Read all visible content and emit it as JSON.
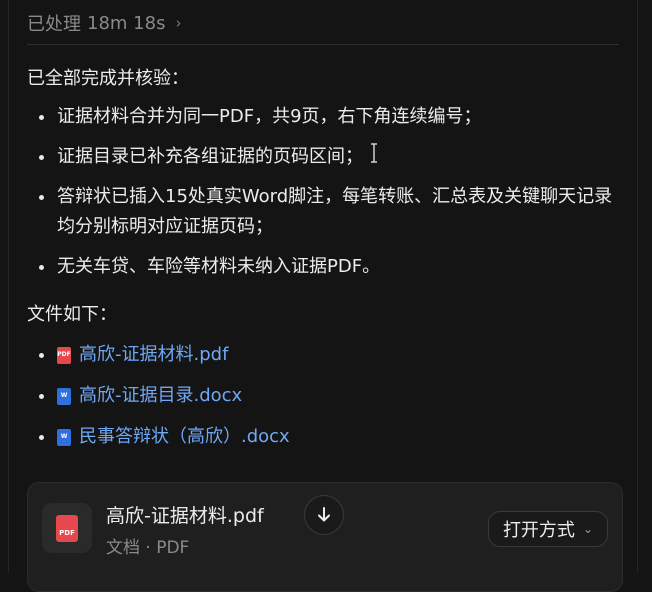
{
  "header": {
    "status_label": "已处理",
    "duration": "18m 18s",
    "chevron_icon": "chevron-right-icon"
  },
  "summary": {
    "intro": "已全部完成并核验：",
    "bullets": [
      "证据材料合并为同一PDF，共9页，右下角连续编号；",
      "证据目录已补充各组证据的页码区间；",
      "答辩状已插入15处真实Word脚注，每笔转账、汇总表及关键聊天记录均分别标明对应证据页码；",
      "无关车贷、车险等材料未纳入证据PDF。"
    ],
    "files_title": "文件如下：",
    "files": [
      {
        "name": "高欣-证据材料.pdf",
        "icon": "pdf-file-icon",
        "badge": "PDF"
      },
      {
        "name": "高欣-证据目录.docx",
        "icon": "word-file-icon",
        "badge": "W"
      },
      {
        "name": "民事答辩状（高欣）.docx",
        "icon": "word-file-icon",
        "badge": "W"
      }
    ]
  },
  "attachment": {
    "file_name": "高欣-证据材料.pdf",
    "meta": "文档 · PDF",
    "icon_badge": "PDF",
    "download_icon": "download-arrow-icon",
    "open_with_label": "打开方式",
    "open_with_chevron": "chevron-down-icon"
  },
  "colors": {
    "background": "#141414",
    "text": "#ececec",
    "muted": "#8a8a8a",
    "link": "#6fa8f5",
    "pdf_red": "#e5484d",
    "word_blue": "#2f6fe0"
  }
}
